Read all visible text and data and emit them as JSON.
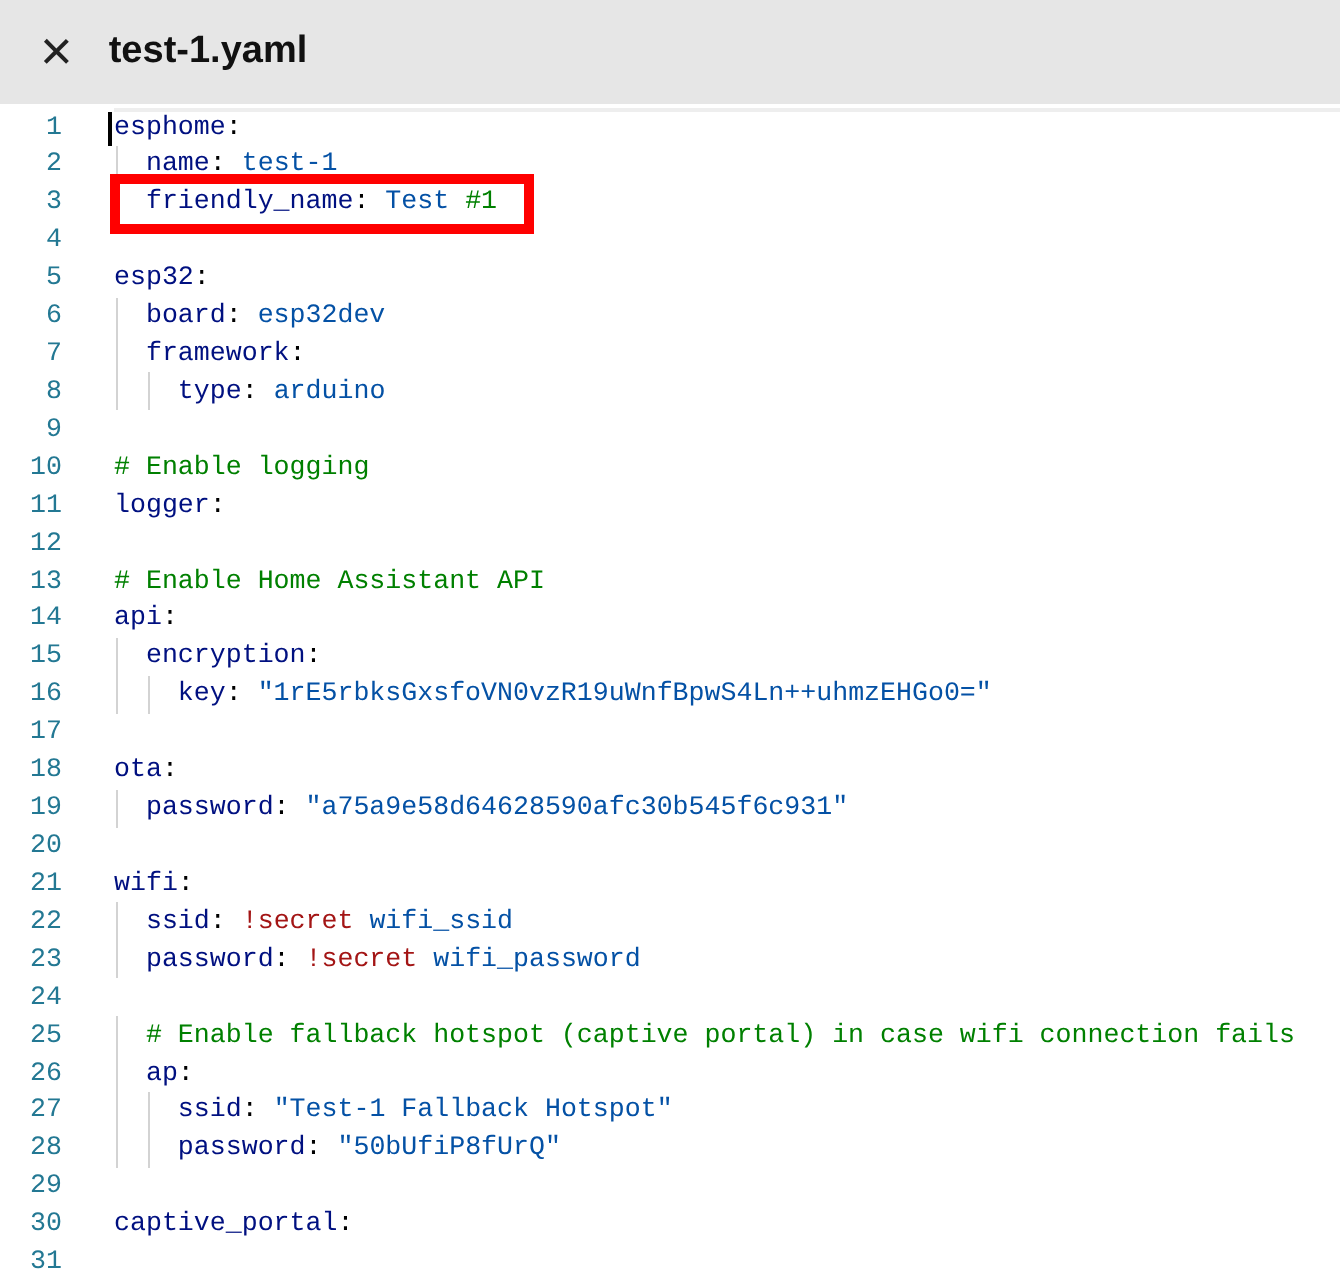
{
  "header": {
    "close_label": "×",
    "title": "test-1.yaml"
  },
  "editor": {
    "lines": [
      {
        "number": "1",
        "current": true,
        "highlighted": false,
        "tokens": [
          {
            "kind": "key",
            "text": "esphome"
          },
          {
            "kind": "punct",
            "text": ":"
          }
        ]
      },
      {
        "number": "2",
        "current": false,
        "highlighted": false,
        "tokens": [
          {
            "kind": "key",
            "text": "  name"
          },
          {
            "kind": "punct",
            "text": ": "
          },
          {
            "kind": "value",
            "text": "test-1"
          }
        ]
      },
      {
        "number": "3",
        "current": false,
        "highlighted": true,
        "tokens": [
          {
            "kind": "key",
            "text": "  friendly_name"
          },
          {
            "kind": "punct",
            "text": ": "
          },
          {
            "kind": "value",
            "text": "Test "
          },
          {
            "kind": "comment",
            "text": "#1"
          }
        ]
      },
      {
        "number": "4",
        "current": false,
        "highlighted": false
      },
      {
        "number": "5",
        "current": false,
        "highlighted": false,
        "tokens": [
          {
            "kind": "key",
            "text": "esp32"
          },
          {
            "kind": "punct",
            "text": ":"
          }
        ]
      },
      {
        "number": "6",
        "current": false,
        "highlighted": false,
        "tokens": [
          {
            "kind": "key",
            "text": "  board"
          },
          {
            "kind": "punct",
            "text": ": "
          },
          {
            "kind": "value",
            "text": "esp32dev"
          }
        ]
      },
      {
        "number": "7",
        "current": false,
        "highlighted": false,
        "tokens": [
          {
            "kind": "key",
            "text": "  framework"
          },
          {
            "kind": "punct",
            "text": ":"
          }
        ]
      },
      {
        "number": "8",
        "current": false,
        "highlighted": false,
        "tokens": [
          {
            "kind": "key",
            "text": "    type"
          },
          {
            "kind": "punct",
            "text": ": "
          },
          {
            "kind": "value",
            "text": "arduino"
          }
        ]
      },
      {
        "number": "9",
        "current": false,
        "highlighted": false
      },
      {
        "number": "10",
        "current": false,
        "highlighted": false,
        "tokens": [
          {
            "kind": "comment",
            "text": "# Enable logging"
          }
        ]
      },
      {
        "number": "11",
        "current": false,
        "highlighted": false,
        "tokens": [
          {
            "kind": "key",
            "text": "logger"
          },
          {
            "kind": "punct",
            "text": ":"
          }
        ]
      },
      {
        "number": "12",
        "current": false,
        "highlighted": false
      },
      {
        "number": "13",
        "current": false,
        "highlighted": false,
        "tokens": [
          {
            "kind": "comment",
            "text": "# Enable Home Assistant API"
          }
        ]
      },
      {
        "number": "14",
        "current": false,
        "highlighted": false,
        "tokens": [
          {
            "kind": "key",
            "text": "api"
          },
          {
            "kind": "punct",
            "text": ":"
          }
        ]
      },
      {
        "number": "15",
        "current": false,
        "highlighted": false,
        "tokens": [
          {
            "kind": "key",
            "text": "  encryption"
          },
          {
            "kind": "punct",
            "text": ":"
          }
        ]
      },
      {
        "number": "16",
        "current": false,
        "highlighted": false,
        "tokens": [
          {
            "kind": "key",
            "text": "    key"
          },
          {
            "kind": "punct",
            "text": ": "
          },
          {
            "kind": "value",
            "text": "\"1rE5rbksGxsfoVN0vzR19uWnfBpwS4Ln++uhmzEHGo0=\""
          }
        ]
      },
      {
        "number": "17",
        "current": false,
        "highlighted": false
      },
      {
        "number": "18",
        "current": false,
        "highlighted": false,
        "tokens": [
          {
            "kind": "key",
            "text": "ota"
          },
          {
            "kind": "punct",
            "text": ":"
          }
        ]
      },
      {
        "number": "19",
        "current": false,
        "highlighted": false,
        "tokens": [
          {
            "kind": "key",
            "text": "  password"
          },
          {
            "kind": "punct",
            "text": ": "
          },
          {
            "kind": "value",
            "text": "\"a75a9e58d64628590afc30b545f6c931\""
          }
        ]
      },
      {
        "number": "20",
        "current": false,
        "highlighted": false
      },
      {
        "number": "21",
        "current": false,
        "highlighted": false,
        "tokens": [
          {
            "kind": "key",
            "text": "wifi"
          },
          {
            "kind": "punct",
            "text": ":"
          }
        ]
      },
      {
        "number": "22",
        "current": false,
        "highlighted": false,
        "tokens": [
          {
            "kind": "key",
            "text": "  ssid"
          },
          {
            "kind": "punct",
            "text": ": "
          },
          {
            "kind": "tag",
            "text": "!secret"
          },
          {
            "kind": "value",
            "text": " wifi_ssid"
          }
        ]
      },
      {
        "number": "23",
        "current": false,
        "highlighted": false,
        "tokens": [
          {
            "kind": "key",
            "text": "  password"
          },
          {
            "kind": "punct",
            "text": ": "
          },
          {
            "kind": "tag",
            "text": "!secret"
          },
          {
            "kind": "value",
            "text": " wifi_password"
          }
        ]
      },
      {
        "number": "24",
        "current": false,
        "highlighted": false
      },
      {
        "number": "25",
        "current": false,
        "highlighted": false,
        "tokens": [
          {
            "kind": "comment",
            "text": "  # Enable fallback hotspot (captive portal) in case wifi connection fails"
          }
        ]
      },
      {
        "number": "26",
        "current": false,
        "highlighted": false,
        "tokens": [
          {
            "kind": "key",
            "text": "  ap"
          },
          {
            "kind": "punct",
            "text": ":"
          }
        ]
      },
      {
        "number": "27",
        "current": false,
        "highlighted": false,
        "tokens": [
          {
            "kind": "key",
            "text": "    ssid"
          },
          {
            "kind": "punct",
            "text": ": "
          },
          {
            "kind": "value",
            "text": "\"Test-1 Fallback Hotspot\""
          }
        ]
      },
      {
        "number": "28",
        "current": false,
        "highlighted": false,
        "tokens": [
          {
            "kind": "key",
            "text": "    password"
          },
          {
            "kind": "punct",
            "text": ": "
          },
          {
            "kind": "value",
            "text": "\"50bUfiP8fUrQ\""
          }
        ]
      },
      {
        "number": "29",
        "current": false,
        "highlighted": false
      },
      {
        "number": "30",
        "current": false,
        "highlighted": false,
        "tokens": [
          {
            "kind": "key",
            "text": "captive_portal"
          },
          {
            "kind": "punct",
            "text": ":"
          }
        ]
      },
      {
        "number": "31",
        "current": false,
        "highlighted": false
      }
    ]
  }
}
